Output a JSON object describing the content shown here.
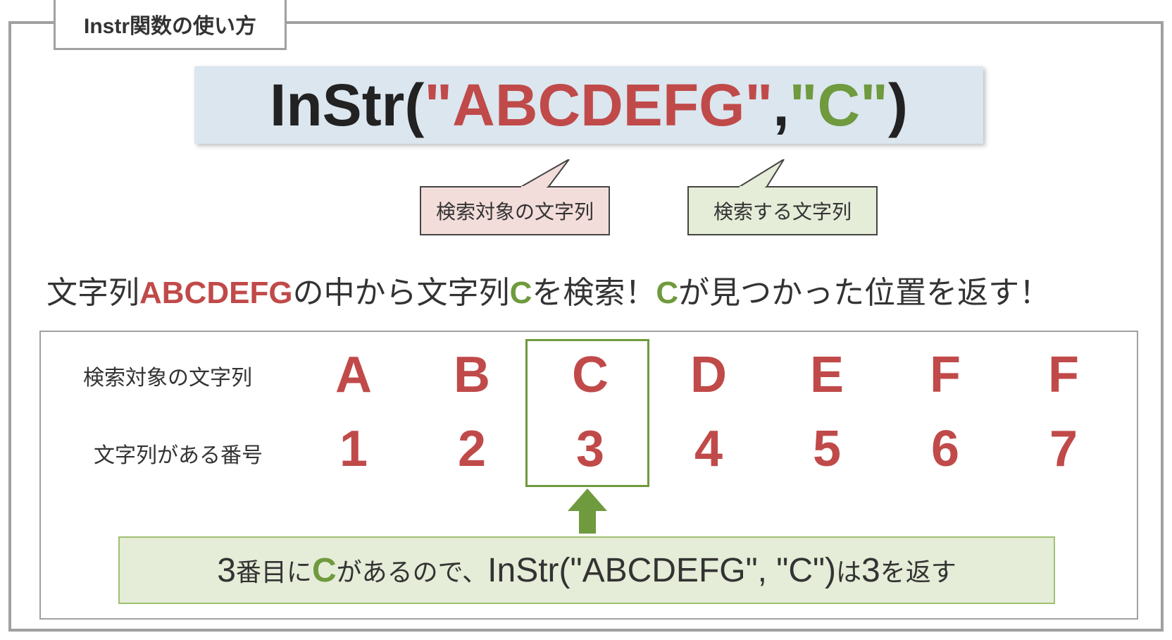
{
  "title": "Instr関数の使い方",
  "code": {
    "fn": "InStr(",
    "arg1_open": "\"",
    "arg1": "ABCDEFG",
    "arg1_close": "\"",
    "sep": ", ",
    "arg2_open": "\"",
    "arg2": "C",
    "arg2_close": "\"",
    "end": ")"
  },
  "callout1": "検索対象の文字列",
  "callout2": "検索する文字列",
  "explain": {
    "t1": "文字列",
    "red1": "ABCDEFG",
    "t2": "の中から文字列",
    "green1": "C",
    "t3": "を検索！",
    "green2": "C",
    "t4": "が見つかった位置を返す！"
  },
  "panel": {
    "rowLabel1": "検索対象の文字列",
    "rowLabel2": "文字列がある番号",
    "letters": [
      "A",
      "B",
      "C",
      "D",
      "E",
      "F",
      "F"
    ],
    "numbers": [
      "1",
      "2",
      "3",
      "4",
      "5",
      "6",
      "7"
    ]
  },
  "result": {
    "p1": "3",
    "p2": "番目に",
    "p3": "C",
    "p4": "があるので、",
    "p5": "InStr(\"ABCDEFG\", \"C\")",
    "p6": "は",
    "p7": "3",
    "p8": "を返す"
  }
}
